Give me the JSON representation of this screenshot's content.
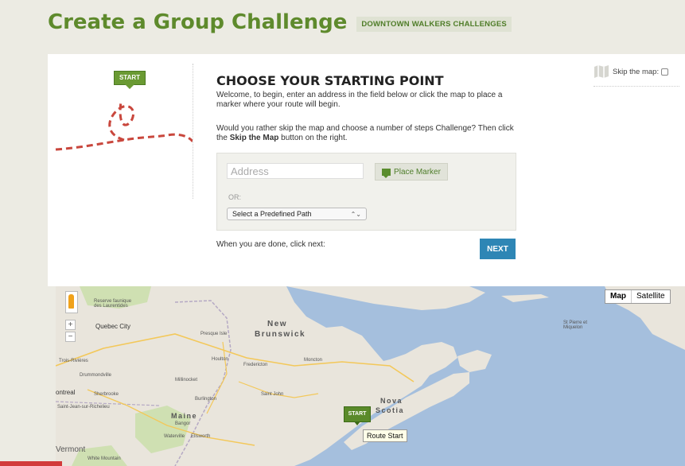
{
  "header": {
    "title": "Create a Group Challenge",
    "group_tag": "DOWNTOWN WALKERS CHALLENGES"
  },
  "panel": {
    "start_flag": "START",
    "section_title": "CHOOSE YOUR STARTING POINT",
    "intro": "Welcome, to begin, enter an address in the field below or click the map to place a marker where your route will begin.",
    "alt_pre": "Would you rather skip the map and choose a number of steps Challenge? Then click the ",
    "alt_bold": "Skip the Map",
    "alt_post": " button on the right.",
    "address_placeholder": "Address",
    "place_marker_label": "Place Marker",
    "or_label": "OR:",
    "path_select_value": "Select a Predefined Path",
    "done_text": "When you are done, click next:",
    "next_label": "NEXT",
    "skip_label": "Skip the map:"
  },
  "map": {
    "type_map": "Map",
    "type_satellite": "Satellite",
    "zoom_in": "+",
    "zoom_out": "−",
    "marker_label": "START",
    "route_tip": "Route Start",
    "labels": {
      "reserve": "Reserve faunique\ndes Laurentides",
      "quebec_city": "Quebec City",
      "trois_rivieres": "Trois-Rivières",
      "drummondville": "Drummondville",
      "montreal": "ontreal",
      "sherbrooke": "Sherbrooke",
      "saint_jean": "Saint-Jean-sur-Richelieu",
      "vermont": "Vermont",
      "white_mountain": "White Mountain",
      "presque_isle": "Presque Isle",
      "new_brunswick_1": "New",
      "new_brunswick_2": "Brunswick",
      "houlton": "Houlton",
      "fredericton": "Fredericton",
      "moncton": "Moncton",
      "millinocket": "Millinocket",
      "burlington": "Burlington",
      "maine": "Maine",
      "bangor": "Bangor",
      "waterville": "Waterville",
      "ellsworth": "Ellsworth",
      "saint_john": "Saint John",
      "nova_scotia_1": "Nova",
      "nova_scotia_2": "Scotia",
      "st_pierre": "St Pierre et\nMiquelon"
    }
  },
  "colors": {
    "title_green": "#5e8a2c",
    "next_blue": "#2e86b5",
    "water": "#a5bfdd",
    "land": "#e9e5dc"
  }
}
